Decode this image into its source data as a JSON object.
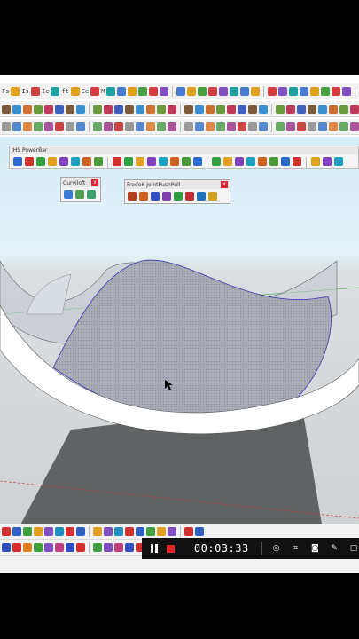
{
  "toolbar": {
    "row1_labels": [
      "Fs",
      "Is",
      "Ic",
      "ft",
      "Ce",
      "M"
    ],
    "row1_colors": [
      "#4a7bd0",
      "#e0a020",
      "#44a040",
      "#d04040",
      "#8050c0",
      "#20a0a0"
    ],
    "row2_colors": [
      "#7b5b3a",
      "#3a8fd0",
      "#d07030",
      "#6a9a3a",
      "#c03b5b",
      "#4060c0"
    ],
    "row3_colors": [
      "#999999",
      "#5588cc",
      "#dd8844",
      "#66aa66",
      "#aa5599",
      "#cc4444"
    ]
  },
  "powerbar": {
    "title": "JHS PowerBar",
    "icon_colors": [
      "#2a6ad0",
      "#d03030",
      "#30a040",
      "#e0a020",
      "#8040c0",
      "#20a0c0",
      "#d06020",
      "#4a9a3a"
    ]
  },
  "curviloft": {
    "title": "Curviloft",
    "close_label": "x",
    "icon_colors": [
      "#3a7ad0",
      "#50a050",
      "#3aa070"
    ]
  },
  "fredo": {
    "title": "Fredo6 JointPushPull",
    "close_label": "x",
    "icon_colors": [
      "#b04020",
      "#d06020",
      "#3050c0",
      "#8040b0",
      "#30a040",
      "#c03030",
      "#2070c0",
      "#d0a020"
    ]
  },
  "bottom": {
    "row1_colors": [
      "#d03030",
      "#3060c0",
      "#40a040",
      "#e0a020",
      "#8050c0",
      "#2090c0"
    ],
    "row2_colors": [
      "#3050c0",
      "#d03030",
      "#e08020",
      "#40a040",
      "#8050c0",
      "#c04080"
    ]
  },
  "recorder": {
    "time": "00:03:33",
    "accent": "#e02727"
  }
}
